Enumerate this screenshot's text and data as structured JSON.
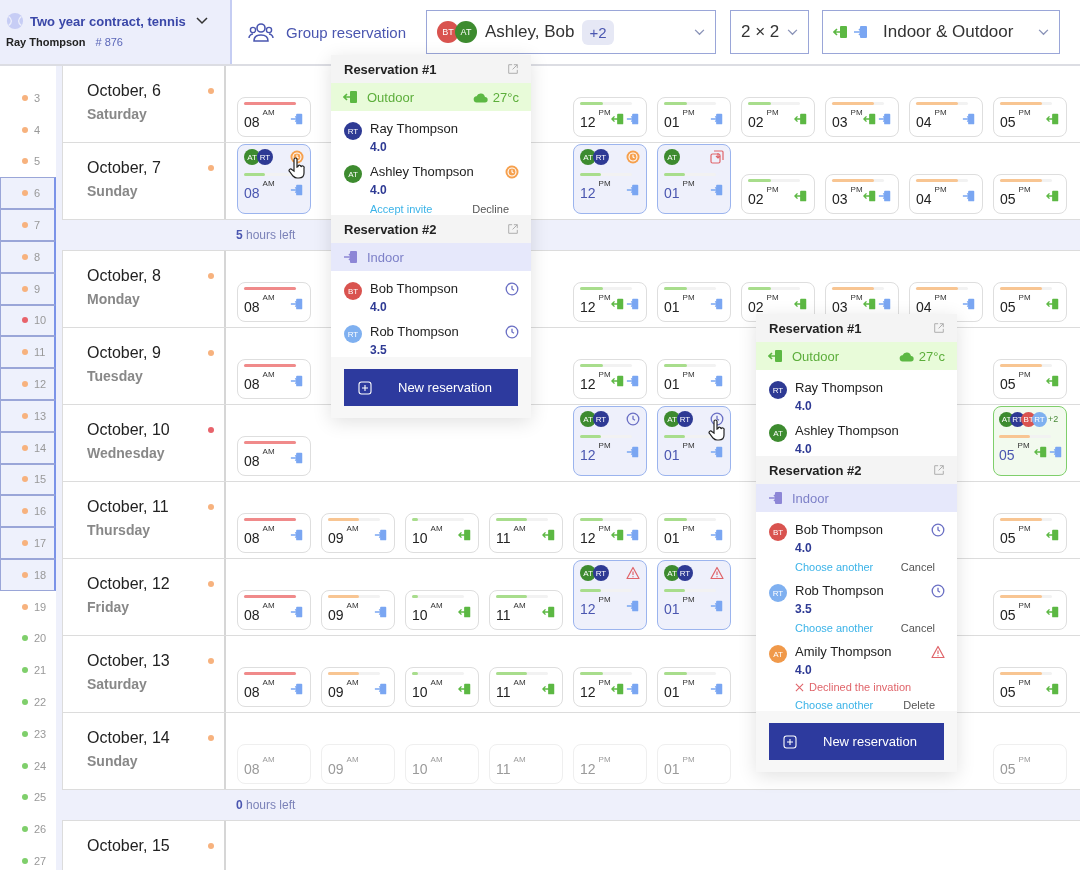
{
  "contract": {
    "title": "Two year contract, tennis",
    "owner": "Ray Thompson",
    "number": "# 876"
  },
  "toolbar": {
    "group": "Group reservation",
    "players": {
      "avatars": [
        {
          "initials": "BT",
          "color": "#d9534f"
        },
        {
          "initials": "AT",
          "color": "#3d8b2f"
        }
      ],
      "names": "Ashley, Bob",
      "extra": "+2"
    },
    "format": "2 × 2",
    "venue": "Indoor & Outdoor"
  },
  "weeks": [
    {
      "week": "3",
      "color": "#f7b27e",
      "selected": false
    },
    {
      "week": "4",
      "color": "#f7b27e",
      "selected": false
    },
    {
      "week": "5",
      "color": "#f7b27e",
      "selected": false
    },
    {
      "week": "6",
      "color": "#f7b27e",
      "selected": true
    },
    {
      "week": "7",
      "color": "#f7b27e",
      "selected": true
    },
    {
      "week": "8",
      "color": "#f7b27e",
      "selected": true
    },
    {
      "week": "9",
      "color": "#f7b27e",
      "selected": true
    },
    {
      "week": "10",
      "color": "#e8636b",
      "selected": true
    },
    {
      "week": "11",
      "color": "#f7b27e",
      "selected": true
    },
    {
      "week": "12",
      "color": "#f7b27e",
      "selected": true
    },
    {
      "week": "13",
      "color": "#f7b27e",
      "selected": true
    },
    {
      "week": "14",
      "color": "#f7b27e",
      "selected": true
    },
    {
      "week": "15",
      "color": "#f7b27e",
      "selected": true
    },
    {
      "week": "16",
      "color": "#f7b27e",
      "selected": true
    },
    {
      "week": "17",
      "color": "#f7b27e",
      "selected": true
    },
    {
      "week": "18",
      "color": "#f7b27e",
      "selected": true
    },
    {
      "week": "19",
      "color": "#f7b27e",
      "selected": false
    },
    {
      "week": "20",
      "color": "#7fcf6b",
      "selected": false
    },
    {
      "week": "21",
      "color": "#7fcf6b",
      "selected": false
    },
    {
      "week": "22",
      "color": "#7fcf6b",
      "selected": false
    },
    {
      "week": "23",
      "color": "#7fcf6b",
      "selected": false
    },
    {
      "week": "24",
      "color": "#7fcf6b",
      "selected": false
    },
    {
      "week": "25",
      "color": "#7fcf6b",
      "selected": false
    },
    {
      "week": "26",
      "color": "#7fcf6b",
      "selected": false
    },
    {
      "week": "27",
      "color": "#7fcf6b",
      "selected": false
    }
  ],
  "rows": [
    {
      "kind": "day",
      "date": "October, 6",
      "weekday": "Saturday",
      "color": "#f7b27e",
      "disabled": false,
      "slots": [
        {
          "kind": "indoor",
          "hour": "08",
          "period": "AM",
          "color": "#f08a8a",
          "level": 1
        },
        {
          "kind": "gap"
        },
        {
          "kind": "gap"
        },
        {
          "kind": "gap"
        },
        {
          "kind": "both",
          "hour": "12",
          "period": "PM",
          "color": "#a8dd8c",
          "level": 0.45
        },
        {
          "kind": "indoor",
          "hour": "01",
          "period": "PM",
          "color": "#a8dd8c",
          "level": 0.45
        },
        {
          "kind": "outdoor",
          "hour": "02",
          "period": "PM",
          "color": "#a8dd8c",
          "level": 0.45
        },
        {
          "kind": "both",
          "hour": "03",
          "period": "PM",
          "color": "#f8c592",
          "level": 0.8
        },
        {
          "kind": "indoor",
          "hour": "04",
          "period": "PM",
          "color": "#f8c592",
          "level": 0.8
        },
        {
          "kind": "outdoor",
          "hour": "05",
          "period": "PM",
          "color": "#f8c592",
          "level": 0.8
        }
      ]
    },
    {
      "kind": "day",
      "date": "October, 7",
      "weekday": "Sunday",
      "color": "#f7b27e",
      "disabled": false,
      "slots": [
        {
          "kind": "indoor",
          "hour": "08",
          "period": "AM",
          "color": "#a8dd8c",
          "level": 0.4,
          "booking": {
            "kind": "invite",
            "cursor": true,
            "avatars": [
              {
                "initials": "AT",
                "color": "#3d8b2f"
              },
              {
                "initials": "RT",
                "color": "#2e3a94"
              }
            ]
          }
        },
        {
          "kind": "gap"
        },
        {
          "kind": "gap"
        },
        {
          "kind": "gap"
        },
        {
          "kind": "indoor",
          "hour": "12",
          "period": "PM",
          "color": "#a8dd8c",
          "level": 0.4,
          "booking": {
            "kind": "invite",
            "cursor": false,
            "avatars": [
              {
                "initials": "AT",
                "color": "#3d8b2f"
              },
              {
                "initials": "RT",
                "color": "#2e3a94"
              }
            ]
          }
        },
        {
          "kind": "indoor",
          "hour": "01",
          "period": "PM",
          "color": "#a8dd8c",
          "level": 0.4,
          "booking": {
            "kind": "moved",
            "cursor": false,
            "avatars": [
              {
                "initials": "AT",
                "color": "#3d8b2f"
              }
            ]
          }
        },
        {
          "kind": "outdoor",
          "hour": "02",
          "period": "PM",
          "color": "#a8dd8c",
          "level": 0.45
        },
        {
          "kind": "both",
          "hour": "03",
          "period": "PM",
          "color": "#f8c592",
          "level": 0.8
        },
        {
          "kind": "indoor",
          "hour": "04",
          "period": "PM",
          "color": "#f8c592",
          "level": 0.8
        },
        {
          "kind": "outdoor",
          "hour": "05",
          "period": "PM",
          "color": "#f8c592",
          "level": 0.8
        }
      ]
    },
    {
      "kind": "separator",
      "count": "5",
      "text": "hours left"
    },
    {
      "kind": "day",
      "date": "October, 8",
      "weekday": "Monday",
      "color": "#f7b27e",
      "disabled": false,
      "slots": [
        {
          "kind": "indoor",
          "hour": "08",
          "period": "AM",
          "color": "#f08a8a",
          "level": 1
        },
        {
          "kind": "gap"
        },
        {
          "kind": "gap"
        },
        {
          "kind": "gap"
        },
        {
          "kind": "both",
          "hour": "12",
          "period": "PM",
          "color": "#a8dd8c",
          "level": 0.45
        },
        {
          "kind": "indoor",
          "hour": "01",
          "period": "PM",
          "color": "#a8dd8c",
          "level": 0.45
        },
        {
          "kind": "outdoor",
          "hour": "02",
          "period": "PM",
          "color": "#a8dd8c",
          "level": 0.45
        },
        {
          "kind": "both",
          "hour": "03",
          "period": "PM",
          "color": "#f8c592",
          "level": 0.8
        },
        {
          "kind": "indoor",
          "hour": "04",
          "period": "PM",
          "color": "#f8c592",
          "level": 0.8
        },
        {
          "kind": "outdoor",
          "hour": "05",
          "period": "PM",
          "color": "#f8c592",
          "level": 0.8
        }
      ]
    },
    {
      "kind": "day",
      "date": "October, 9",
      "weekday": "Tuesday",
      "color": "#f7b27e",
      "disabled": false,
      "slots": [
        {
          "kind": "indoor",
          "hour": "08",
          "period": "AM",
          "color": "#f08a8a",
          "level": 1
        },
        {
          "kind": "gap"
        },
        {
          "kind": "gap"
        },
        {
          "kind": "gap"
        },
        {
          "kind": "both",
          "hour": "12",
          "period": "PM",
          "color": "#a8dd8c",
          "level": 0.45
        },
        {
          "kind": "indoor",
          "hour": "01",
          "period": "PM",
          "color": "#a8dd8c",
          "level": 0.45
        },
        {
          "kind": "gap"
        },
        {
          "kind": "gap"
        },
        {
          "kind": "gap"
        },
        {
          "kind": "outdoor",
          "hour": "05",
          "period": "PM",
          "color": "#f8c592",
          "level": 0.8
        }
      ]
    },
    {
      "kind": "day",
      "date": "October, 10",
      "weekday": "Wednesday",
      "color": "#e8636b",
      "disabled": false,
      "slots": [
        {
          "kind": "indoor",
          "hour": "08",
          "period": "AM",
          "color": "#f08a8a",
          "level": 1
        },
        {
          "kind": "gap"
        },
        {
          "kind": "gap"
        },
        {
          "kind": "gap"
        },
        {
          "kind": "indoor",
          "hour": "12",
          "period": "PM",
          "color": "#a8dd8c",
          "level": 0.4,
          "booking": {
            "kind": "pending",
            "cursor": false,
            "avatars": [
              {
                "initials": "AT",
                "color": "#3d8b2f"
              },
              {
                "initials": "RT",
                "color": "#2e3a94"
              }
            ]
          }
        },
        {
          "kind": "indoor",
          "hour": "01",
          "period": "PM",
          "color": "#a8dd8c",
          "level": 0.4,
          "booking": {
            "kind": "pending",
            "cursor": true,
            "avatars": [
              {
                "initials": "AT",
                "color": "#3d8b2f"
              },
              {
                "initials": "RT",
                "color": "#2e3a94"
              }
            ]
          }
        },
        {
          "kind": "gap"
        },
        {
          "kind": "gap"
        },
        {
          "kind": "gap"
        },
        {
          "kind": "both",
          "hour": "05",
          "period": "PM",
          "color": "#f8c592",
          "level": 0.6,
          "booking": {
            "kind": "open",
            "cursor": false,
            "avatars": [
              {
                "initials": "AT",
                "color": "#3d8b2f"
              },
              {
                "initials": "RT",
                "color": "#2e3a94"
              },
              {
                "initials": "BT",
                "color": "#d9534f"
              },
              {
                "initials": "RT",
                "color": "#7fb0f0"
              }
            ],
            "extra": "+2"
          }
        }
      ]
    },
    {
      "kind": "day",
      "date": "October, 11",
      "weekday": "Thursday",
      "color": "#f7b27e",
      "disabled": false,
      "slots": [
        {
          "kind": "indoor",
          "hour": "08",
          "period": "AM",
          "color": "#f08a8a",
          "level": 1
        },
        {
          "kind": "indoor",
          "hour": "09",
          "period": "AM",
          "color": "#f8c592",
          "level": 0.6
        },
        {
          "kind": "outdoor",
          "hour": "10",
          "period": "AM",
          "color": "#a8dd8c",
          "level": 0.12
        },
        {
          "kind": "outdoor",
          "hour": "11",
          "period": "AM",
          "color": "#a8dd8c",
          "level": 0.6
        },
        {
          "kind": "both",
          "hour": "12",
          "period": "PM",
          "color": "#a8dd8c",
          "level": 0.45
        },
        {
          "kind": "indoor",
          "hour": "01",
          "period": "PM",
          "color": "#a8dd8c",
          "level": 0.45
        },
        {
          "kind": "gap"
        },
        {
          "kind": "gap"
        },
        {
          "kind": "gap"
        },
        {
          "kind": "outdoor",
          "hour": "05",
          "period": "PM",
          "color": "#f8c592",
          "level": 0.8
        }
      ]
    },
    {
      "kind": "day",
      "date": "October, 12",
      "weekday": "Friday",
      "color": "#f7b27e",
      "disabled": false,
      "slots": [
        {
          "kind": "indoor",
          "hour": "08",
          "period": "AM",
          "color": "#f08a8a",
          "level": 1
        },
        {
          "kind": "indoor",
          "hour": "09",
          "period": "AM",
          "color": "#f8c592",
          "level": 0.6
        },
        {
          "kind": "outdoor",
          "hour": "10",
          "period": "AM",
          "color": "#a8dd8c",
          "level": 0.12
        },
        {
          "kind": "outdoor",
          "hour": "11",
          "period": "AM",
          "color": "#a8dd8c",
          "level": 0.6
        },
        {
          "kind": "indoor",
          "hour": "12",
          "period": "PM",
          "color": "#a8dd8c",
          "level": 0.4,
          "booking": {
            "kind": "declined",
            "cursor": false,
            "avatars": [
              {
                "initials": "AT",
                "color": "#3d8b2f"
              },
              {
                "initials": "RT",
                "color": "#2e3a94"
              }
            ]
          }
        },
        {
          "kind": "indoor",
          "hour": "01",
          "period": "PM",
          "color": "#a8dd8c",
          "level": 0.4,
          "booking": {
            "kind": "declined",
            "cursor": false,
            "avatars": [
              {
                "initials": "AT",
                "color": "#3d8b2f"
              },
              {
                "initials": "RT",
                "color": "#2e3a94"
              }
            ]
          }
        },
        {
          "kind": "gap"
        },
        {
          "kind": "gap"
        },
        {
          "kind": "gap"
        },
        {
          "kind": "outdoor",
          "hour": "05",
          "period": "PM",
          "color": "#f8c592",
          "level": 0.8
        }
      ]
    },
    {
      "kind": "day",
      "date": "October, 13",
      "weekday": "Saturday",
      "color": "#f7b27e",
      "disabled": false,
      "slots": [
        {
          "kind": "indoor",
          "hour": "08",
          "period": "AM",
          "color": "#f08a8a",
          "level": 1
        },
        {
          "kind": "indoor",
          "hour": "09",
          "period": "AM",
          "color": "#f8c592",
          "level": 0.6
        },
        {
          "kind": "outdoor",
          "hour": "10",
          "period": "AM",
          "color": "#a8dd8c",
          "level": 0.12
        },
        {
          "kind": "outdoor",
          "hour": "11",
          "period": "AM",
          "color": "#a8dd8c",
          "level": 0.6
        },
        {
          "kind": "both",
          "hour": "12",
          "period": "PM",
          "color": "#a8dd8c",
          "level": 0.45
        },
        {
          "kind": "indoor",
          "hour": "01",
          "period": "PM",
          "color": "#a8dd8c",
          "level": 0.45
        },
        {
          "kind": "gap"
        },
        {
          "kind": "gap"
        },
        {
          "kind": "gap"
        },
        {
          "kind": "outdoor",
          "hour": "05",
          "period": "PM",
          "color": "#f8c592",
          "level": 0.8
        }
      ]
    },
    {
      "kind": "day",
      "date": "October, 14",
      "weekday": "Sunday",
      "color": "#f7b27e",
      "disabled": true,
      "slots": [
        {
          "kind": "closed",
          "hour": "08",
          "period": "AM"
        },
        {
          "kind": "closed",
          "hour": "09",
          "period": "AM"
        },
        {
          "kind": "closed",
          "hour": "10",
          "period": "AM"
        },
        {
          "kind": "closed",
          "hour": "11",
          "period": "AM"
        },
        {
          "kind": "closed",
          "hour": "12",
          "period": "PM"
        },
        {
          "kind": "closed",
          "hour": "01",
          "period": "PM"
        },
        {
          "kind": "gap"
        },
        {
          "kind": "gap"
        },
        {
          "kind": "gap"
        },
        {
          "kind": "closed",
          "hour": "05",
          "period": "PM"
        }
      ]
    },
    {
      "kind": "separator",
      "count": "0",
      "text": "hours left"
    },
    {
      "kind": "day",
      "date": "October, 15",
      "color": "#f7b27e"
    }
  ],
  "popovers": [
    {
      "reservations": [
        {
          "title": "Reservation #1",
          "kind": "outdoor",
          "venue_label": "Outdoor",
          "weather": "27°c",
          "members": [
            {
              "initials": "RT",
              "color": "#2e3a94",
              "name": "Ray Thompson",
              "rating": "4.0"
            },
            {
              "initials": "AT",
              "color": "#3d8b2f",
              "name": "Ashley Thompson",
              "rating": "4.0",
              "kind": "invite",
              "actions": [
                {
                  "label": "Accept invite",
                  "kind": "link"
                },
                {
                  "label": "Decline",
                  "kind": "plain"
                }
              ]
            }
          ]
        },
        {
          "title": "Reservation #2",
          "kind": "indoor",
          "venue_label": "Indoor",
          "members": [
            {
              "initials": "BT",
              "color": "#d9534f",
              "name": "Bob Thompson",
              "rating": "4.0",
              "kind": "pending"
            },
            {
              "initials": "RT",
              "color": "#7fb0f0",
              "name": "Rob Thompson",
              "rating": "3.5",
              "kind": "pending"
            }
          ]
        }
      ],
      "button": "New reservation"
    },
    {
      "reservations": [
        {
          "title": "Reservation #1",
          "kind": "outdoor",
          "venue_label": "Outdoor",
          "weather": "27°c",
          "members": [
            {
              "initials": "RT",
              "color": "#2e3a94",
              "name": "Ray Thompson",
              "rating": "4.0"
            },
            {
              "initials": "AT",
              "color": "#3d8b2f",
              "name": "Ashley Thompson",
              "rating": "4.0"
            }
          ]
        },
        {
          "title": "Reservation #2",
          "kind": "indoor",
          "venue_label": "Indoor",
          "members": [
            {
              "initials": "BT",
              "color": "#d9534f",
              "name": "Bob Thompson",
              "rating": "4.0",
              "kind": "pending",
              "actions": [
                {
                  "label": "Choose another",
                  "kind": "link"
                },
                {
                  "label": "Cancel",
                  "kind": "plain"
                }
              ]
            },
            {
              "initials": "RT",
              "color": "#7fb0f0",
              "name": "Rob Thompson",
              "rating": "3.5",
              "kind": "pending",
              "actions": [
                {
                  "label": "Choose another",
                  "kind": "link"
                },
                {
                  "label": "Cancel",
                  "kind": "plain"
                }
              ]
            },
            {
              "initials": "AT",
              "color": "#f0994a",
              "name": "Amily Thompson",
              "rating": "4.0",
              "kind": "declined",
              "note": "Declined the invation",
              "actions": [
                {
                  "label": "Choose another",
                  "kind": "link"
                },
                {
                  "label": "Delete",
                  "kind": "plain"
                }
              ]
            }
          ]
        }
      ],
      "button": "New reservation"
    }
  ]
}
